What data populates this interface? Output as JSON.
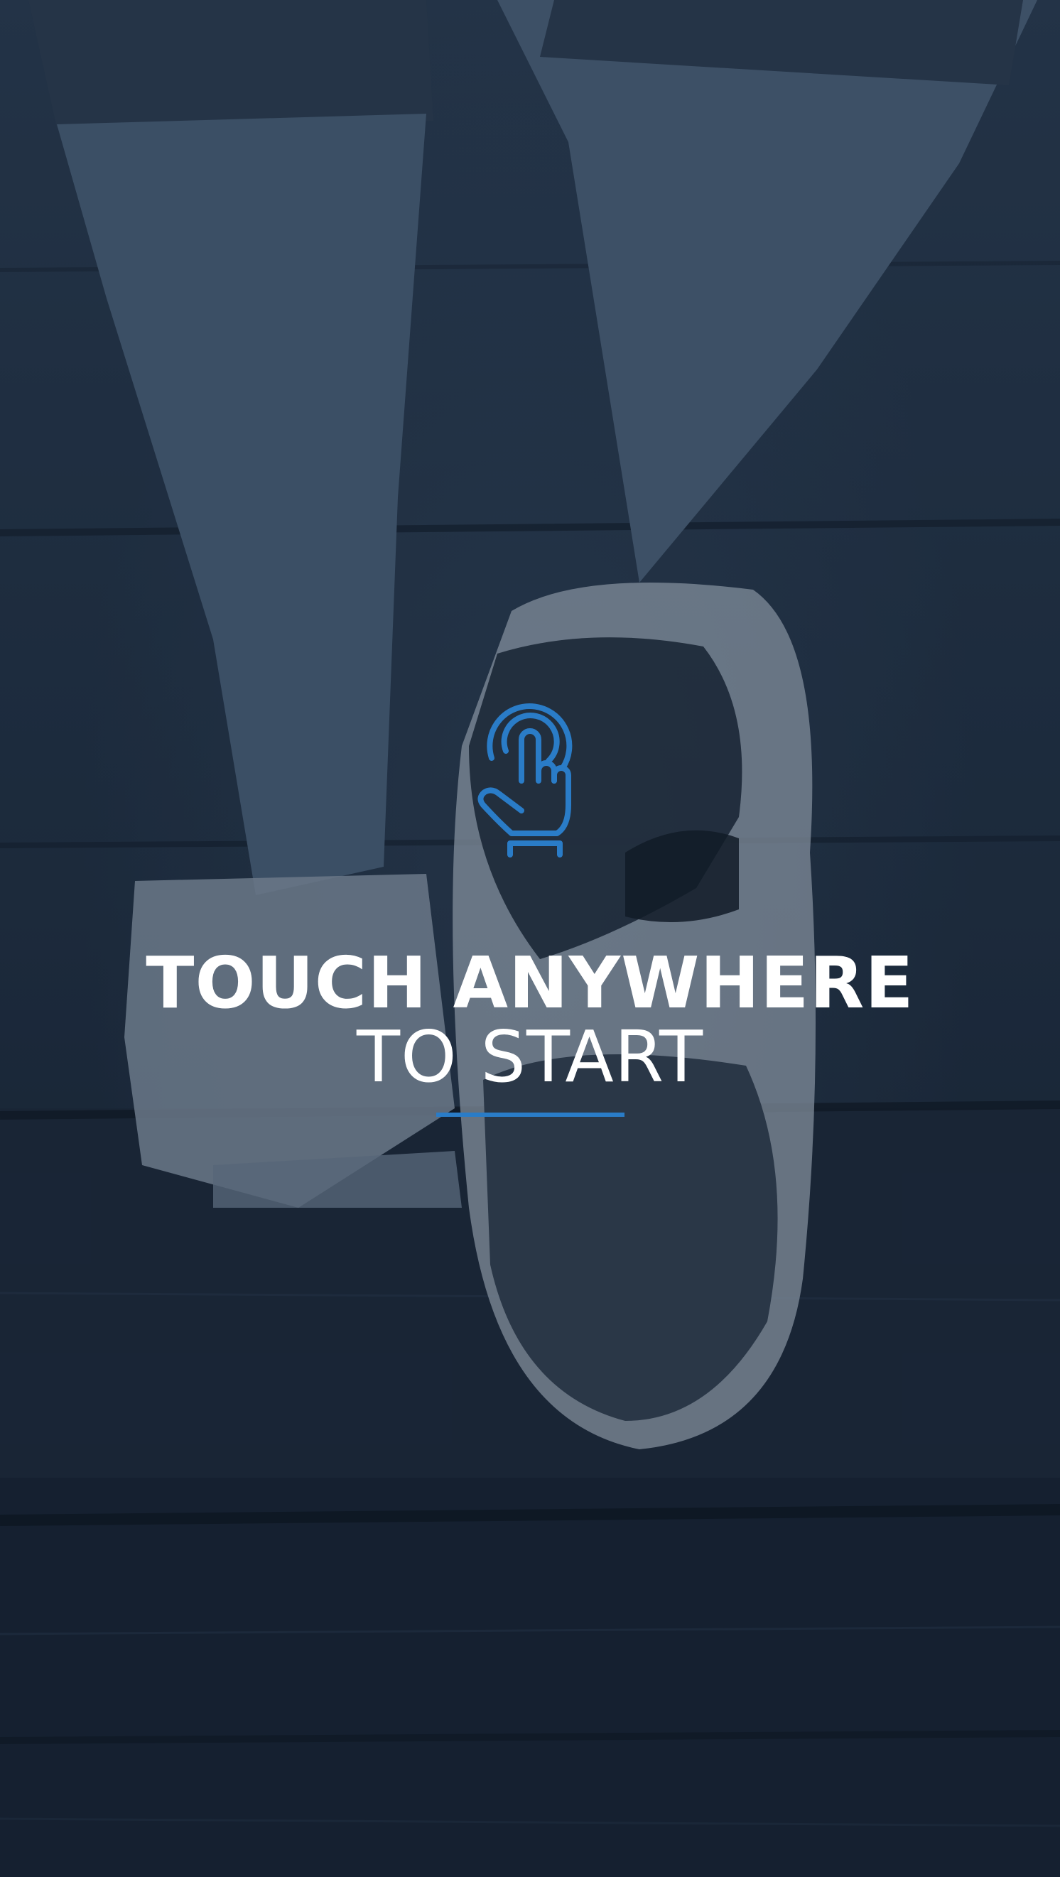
{
  "start_screen": {
    "title_line_1": "TOUCH ANYWHERE",
    "title_line_2": "TO START",
    "icon": "tap-gesture-icon",
    "background": "walking-feet-photo",
    "accent_color": "#2a7cc7",
    "text_color": "#ffffff",
    "overlay_color": "#1b2636"
  }
}
